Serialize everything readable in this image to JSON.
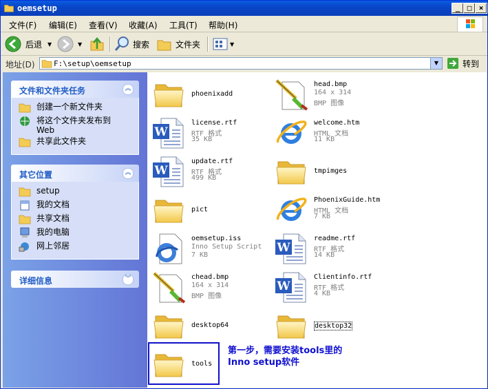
{
  "window": {
    "title": "oemsetup"
  },
  "menubar": [
    "文件(F)",
    "编辑(E)",
    "查看(V)",
    "收藏(A)",
    "工具(T)",
    "帮助(H)"
  ],
  "toolbar": {
    "back": "后退",
    "search": "搜索",
    "folders": "文件夹"
  },
  "address": {
    "label": "地址(D)",
    "path": "F:\\setup\\oemsetup",
    "go": "转到"
  },
  "panels": {
    "tasks": {
      "title": "文件和文件夹任务",
      "items": [
        "创建一个新文件夹",
        "将这个文件夹发布到",
        "Web",
        "共享此文件夹"
      ]
    },
    "places": {
      "title": "其它位置",
      "items": [
        "setup",
        "我的文档",
        "共享文档",
        "我的电脑",
        "网上邻居"
      ]
    },
    "details": {
      "title": "详细信息"
    }
  },
  "files": [
    {
      "name": "phoenixadd"
    },
    {
      "name": "head.bmp",
      "sub1": "164 x 314",
      "sub2": "BMP 图像"
    },
    {
      "name": "license.rtf",
      "sub1": "RTF 格式",
      "sub2": "35 KB"
    },
    {
      "name": "welcome.htm",
      "sub1": "HTML 文档",
      "sub2": "11 KB"
    },
    {
      "name": "update.rtf",
      "sub1": "RTF 格式",
      "sub2": "499 KB"
    },
    {
      "name": "tmpimges"
    },
    {
      "name": "pict"
    },
    {
      "name": "PhoenixGuide.htm",
      "sub1": "HTML 文档",
      "sub2": "7 KB"
    },
    {
      "name": "oemsetup.iss",
      "sub1": "Inno Setup Script",
      "sub2": "7 KB"
    },
    {
      "name": "readme.rtf",
      "sub1": "RTF 格式",
      "sub2": "14 KB"
    },
    {
      "name": "chead.bmp",
      "sub1": "164 x 314",
      "sub2": "BMP 图像"
    },
    {
      "name": "Clientinfo.rtf",
      "sub1": "RTF 格式",
      "sub2": "4 KB"
    },
    {
      "name": "desktop64"
    },
    {
      "name": "desktop32"
    },
    {
      "name": "tools"
    }
  ],
  "annotation": {
    "line1": "第一步，需要安装tools里的",
    "line2": "Inno setup软件"
  }
}
